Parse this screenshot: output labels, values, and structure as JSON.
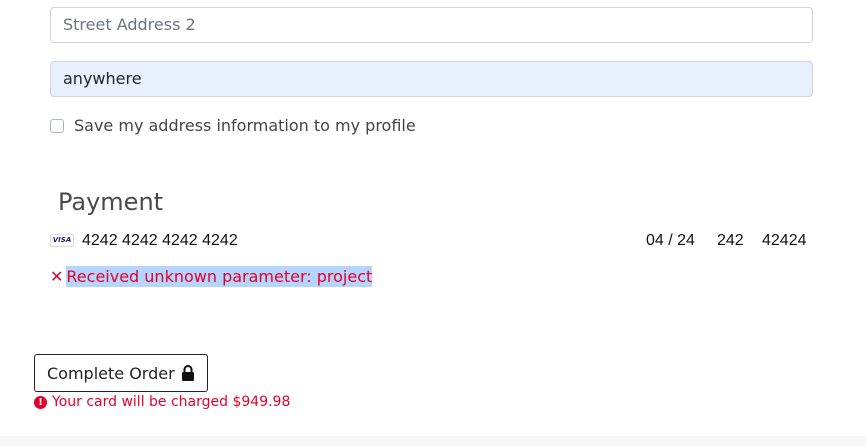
{
  "address": {
    "street2_placeholder": "Street Address 2",
    "city_value": "anywhere",
    "save_checkbox_label": "Save my address information to my profile",
    "save_checked": false
  },
  "payment": {
    "title": "Payment",
    "card_brand": "VISA",
    "card_number": "4242 4242 4242 4242",
    "expiry": "04 / 24",
    "cvc": "242",
    "zip": "42424",
    "error_message": "Received unknown parameter: project"
  },
  "order": {
    "button_label": "Complete Order",
    "charge_notice": "Your card will be charged $949.98"
  },
  "colors": {
    "error": "#e4002b",
    "autofill_bg": "#e8f0fe",
    "selection": "#b4d5fe"
  }
}
